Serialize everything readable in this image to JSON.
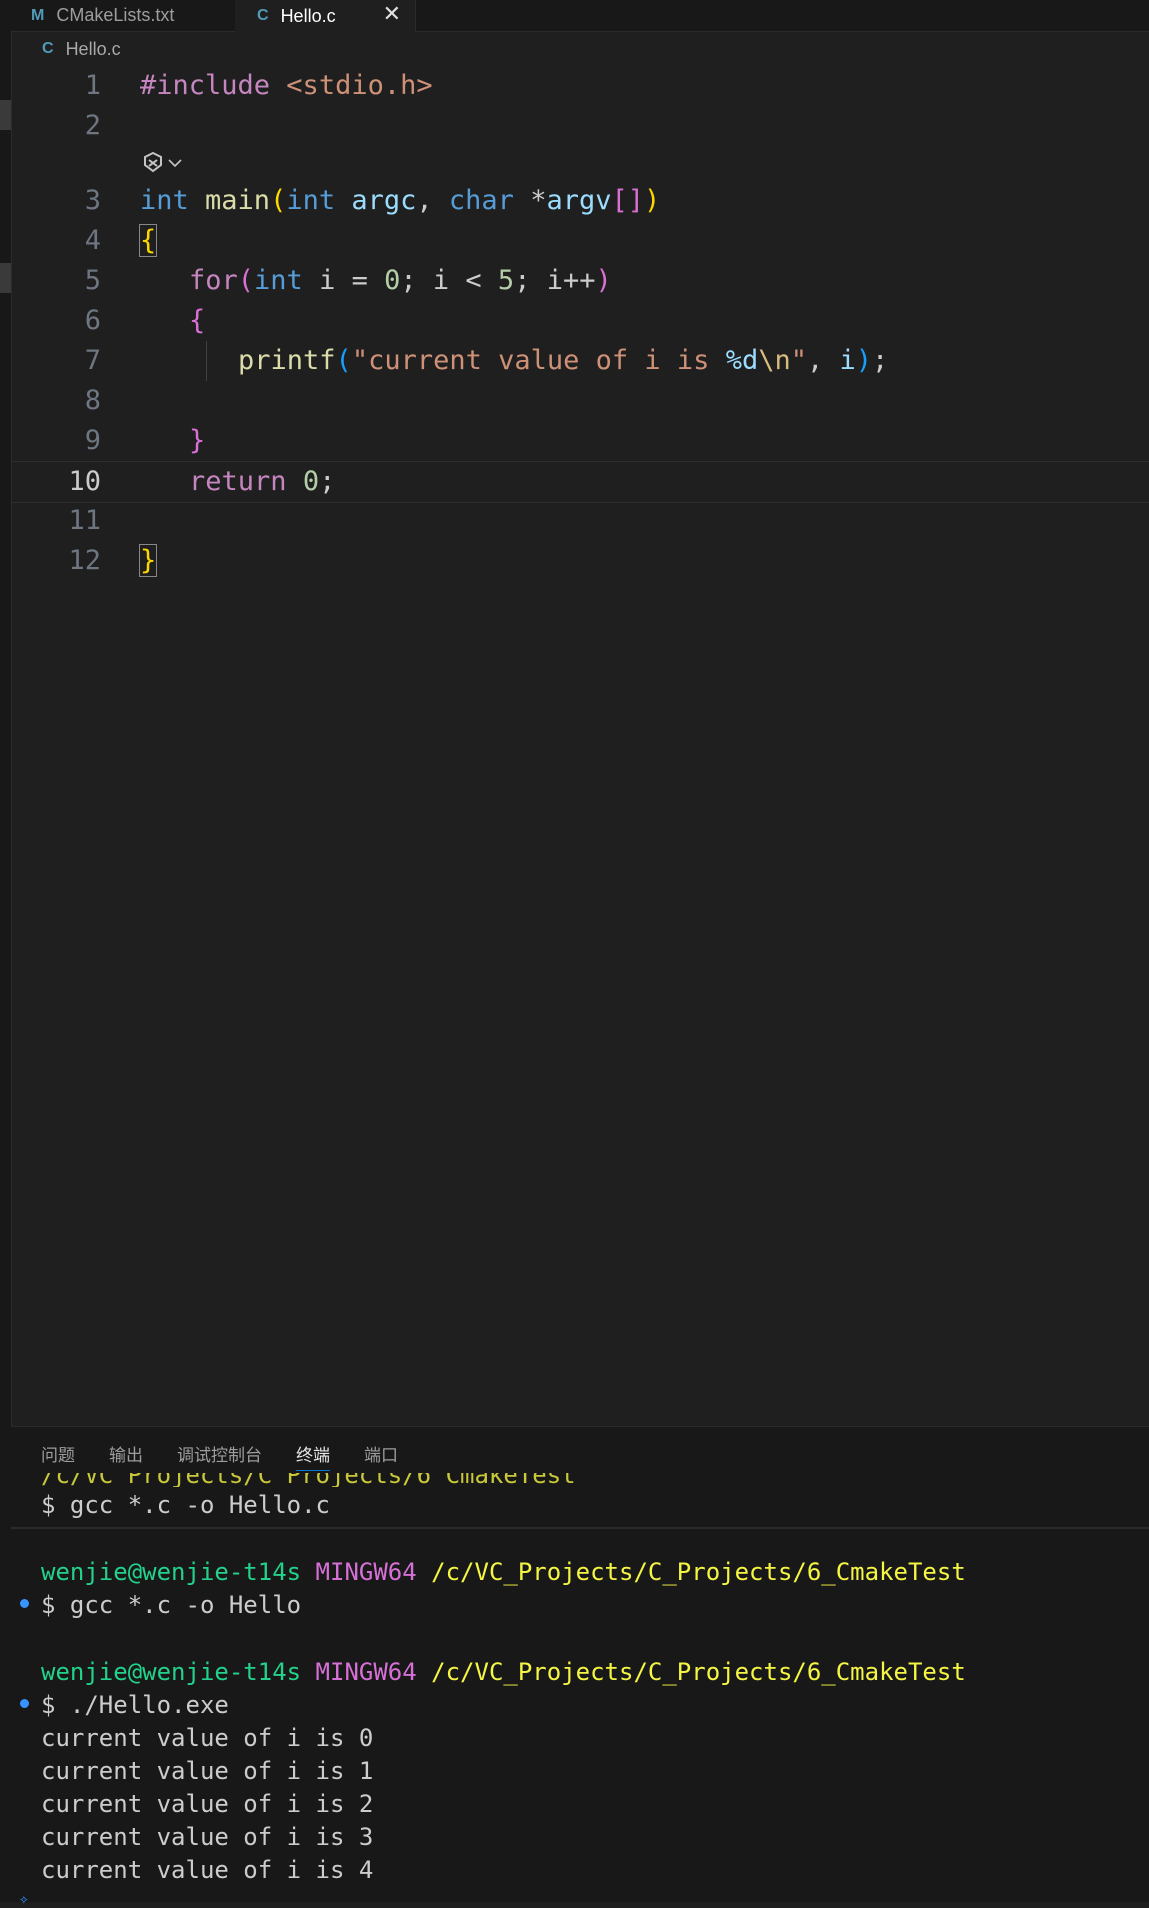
{
  "tabs": [
    {
      "icon": "M",
      "label": "CMakeLists.txt"
    },
    {
      "icon": "C",
      "label": "Hello.c"
    }
  ],
  "breadcrumb": {
    "icon": "C",
    "file": "Hello.c"
  },
  "editor": {
    "line_numbers": [
      "1",
      "2",
      "3",
      "4",
      "5",
      "6",
      "7",
      "8",
      "9",
      "10",
      "11",
      "12"
    ],
    "current_line": "10",
    "code": {
      "l1_directive": "#include",
      "l1_header": " <stdio.h>",
      "l3_int": "int",
      "l3_main": " main",
      "l3_paren_open": "(",
      "l3_int2": "int",
      "l3_argc": " argc",
      "l3_comma": ", ",
      "l3_char": "char",
      "l3_star": " *",
      "l3_argv": "argv",
      "l3_brackets": "[]",
      "l3_paren_close": ")",
      "l4_brace": "{",
      "l5_for": "for",
      "l5_paren_open": "(",
      "l5_int": "int",
      "l5_rest_a": " i = ",
      "l5_zero": "0",
      "l5_rest_b": "; i < ",
      "l5_five": "5",
      "l5_rest_c": "; i++",
      "l5_paren_close": ")",
      "l6_brace": "{",
      "l7_printf": "printf",
      "l7_paren_open": "(",
      "l7_str_a": "\"current value of i is ",
      "l7_fmt": "%d",
      "l7_esc": "\\n",
      "l7_str_b": "\"",
      "l7_comma": ", ",
      "l7_i": "i",
      "l7_paren_close": ")",
      "l7_semi": ";",
      "l9_brace": "}",
      "l10_return": "return",
      "l10_space": " ",
      "l10_zero": "0",
      "l10_semi": ";",
      "l12_brace": "}"
    },
    "codelens_icon": "copilot-icon"
  },
  "panel": {
    "tabs": [
      "问题",
      "输出",
      "调试控制台",
      "终端",
      "端口"
    ],
    "active_tab": "终端",
    "terminal": {
      "sticky_cmd": "$ gcc *.c -o Hello.c",
      "prompt_user": "wenjie@wenjie-t14s",
      "prompt_env": "MINGW64",
      "prompt_path": "/c/VC_Projects/C_Projects/6_CmakeTest",
      "cmd1": "$ gcc *.c -o Hello",
      "cmd2": "$ ./Hello.exe",
      "output": [
        "current value of i is 0",
        "current value of i is 1",
        "current value of i is 2",
        "current value of i is 3",
        "current value of i is 4"
      ]
    }
  }
}
